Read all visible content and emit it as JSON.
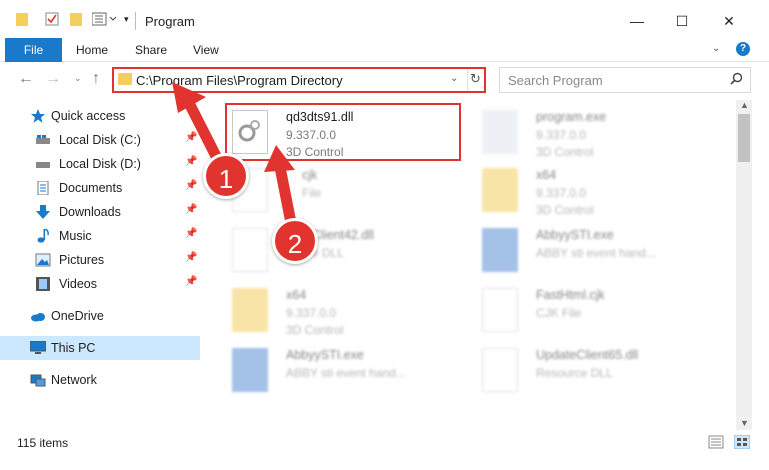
{
  "window": {
    "title": "Program",
    "minimize": "—",
    "maximize": "☐",
    "close": "✕"
  },
  "ribbon": {
    "file_tab": "File",
    "tabs": [
      "Home",
      "Share",
      "View"
    ],
    "help": "?"
  },
  "address": {
    "path": "C:\\Program Files\\Program Directory",
    "search_placeholder": "Search Program"
  },
  "sidebar": {
    "quick_access": "Quick access",
    "items": [
      {
        "label": "Local Disk (C:)"
      },
      {
        "label": "Local Disk (D:)"
      },
      {
        "label": "Documents"
      },
      {
        "label": "Downloads"
      },
      {
        "label": "Music"
      },
      {
        "label": "Pictures"
      },
      {
        "label": "Videos"
      }
    ],
    "onedrive": "OneDrive",
    "this_pc": "This PC",
    "network": "Network"
  },
  "files": [
    {
      "name": "qd3dts91.dll",
      "meta1": "9.337.0.0",
      "meta2": "3D Control"
    },
    {
      "name": "program.exe",
      "meta1": "9.337.0.0",
      "meta2": "3D Control"
    },
    {
      "name": "x64",
      "meta1": "9.337.0.0",
      "meta2": "3D Control"
    },
    {
      "name": "UpdateClient42.dll",
      "meta1": "Resource DLL",
      "meta2": ""
    },
    {
      "name": "AbbyySTI.exe",
      "meta1": "ABBY sti event hand...",
      "meta2": ""
    },
    {
      "name": "x64",
      "meta1": "9.337.0.0",
      "meta2": "3D Control"
    },
    {
      "name": "FastHtml.cjk",
      "meta1": "CJK File",
      "meta2": ""
    },
    {
      "name": "AbbyySTI.exe",
      "meta1": "ABBY sti event hand...",
      "meta2": ""
    },
    {
      "name": "UpdateClient65.dll",
      "meta1": "Resource DLL",
      "meta2": ""
    }
  ],
  "status": {
    "count": "115 items"
  },
  "annotations": {
    "badge1": "1",
    "badge2": "2",
    "color": "#e2342f"
  },
  "colors": {
    "accent": "#1979ca",
    "selected": "#cce8ff",
    "highlight": "#e2342f"
  }
}
